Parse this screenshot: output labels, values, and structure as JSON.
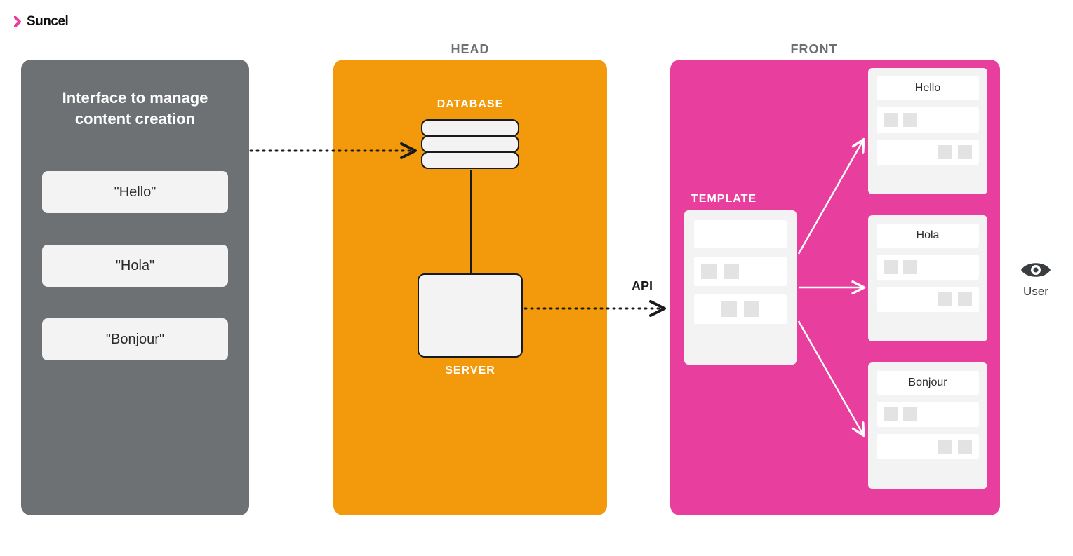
{
  "logo": {
    "text": "Suncel"
  },
  "columns": {
    "head_label": "HEAD",
    "front_label": "FRONT"
  },
  "interface_panel": {
    "title": "Interface to manage content creation",
    "words": [
      "\"Hello\"",
      "\"Hola\"",
      "\"Bonjour\""
    ]
  },
  "head_panel": {
    "database_label": "DATABASE",
    "server_label": "SERVER"
  },
  "front_panel": {
    "template_label": "TEMPLATE",
    "outputs": [
      "Hello",
      "Hola",
      "Bonjour"
    ]
  },
  "connectors": {
    "api_label": "API"
  },
  "user": {
    "label": "User"
  },
  "colors": {
    "gray": "#6e7174",
    "orange": "#f29a0c",
    "pink": "#e83e9e",
    "light": "#f4f3f3"
  }
}
